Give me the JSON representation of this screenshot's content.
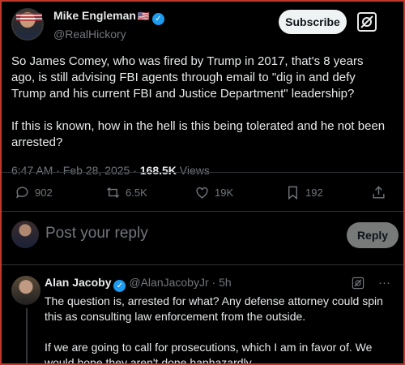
{
  "author": {
    "name": "Mike Engleman",
    "flag": "🇺🇸",
    "handle": "@RealHickory"
  },
  "header": {
    "subscribe_label": "Subscribe"
  },
  "post": {
    "text": "So James Comey, who was fired by Trump in 2017, that's 8 years ago, is still advising FBI agents through email to \"dig in and defy Trump and his current FBI and Justice Department\" leadership?\n\nIf this is known, how in the hell is this being tolerated and he not been arrested?",
    "time": "6:47 AM · Feb 28, 2025 · ",
    "views": "168.5K",
    "views_label": " Views"
  },
  "actions": {
    "replies": "902",
    "reposts": "6.5K",
    "likes": "19K",
    "bookmarks": "192"
  },
  "reply_composer": {
    "placeholder": "Post your reply",
    "button": "Reply"
  },
  "comment": {
    "name": "Alan Jacoby",
    "handle": "@AlanJacobyJr",
    "time": "5h",
    "text": "The question is, arrested for what? Any defense attorney could spin this as consulting law enforcement from the outside.\n\nIf we are going to call for prosecutions, which I am in favor of. We would hope they aren't done haphazardly."
  },
  "colors": {
    "accent": "#1d9bf0",
    "muted": "#71767b",
    "divider": "#2f3336"
  }
}
